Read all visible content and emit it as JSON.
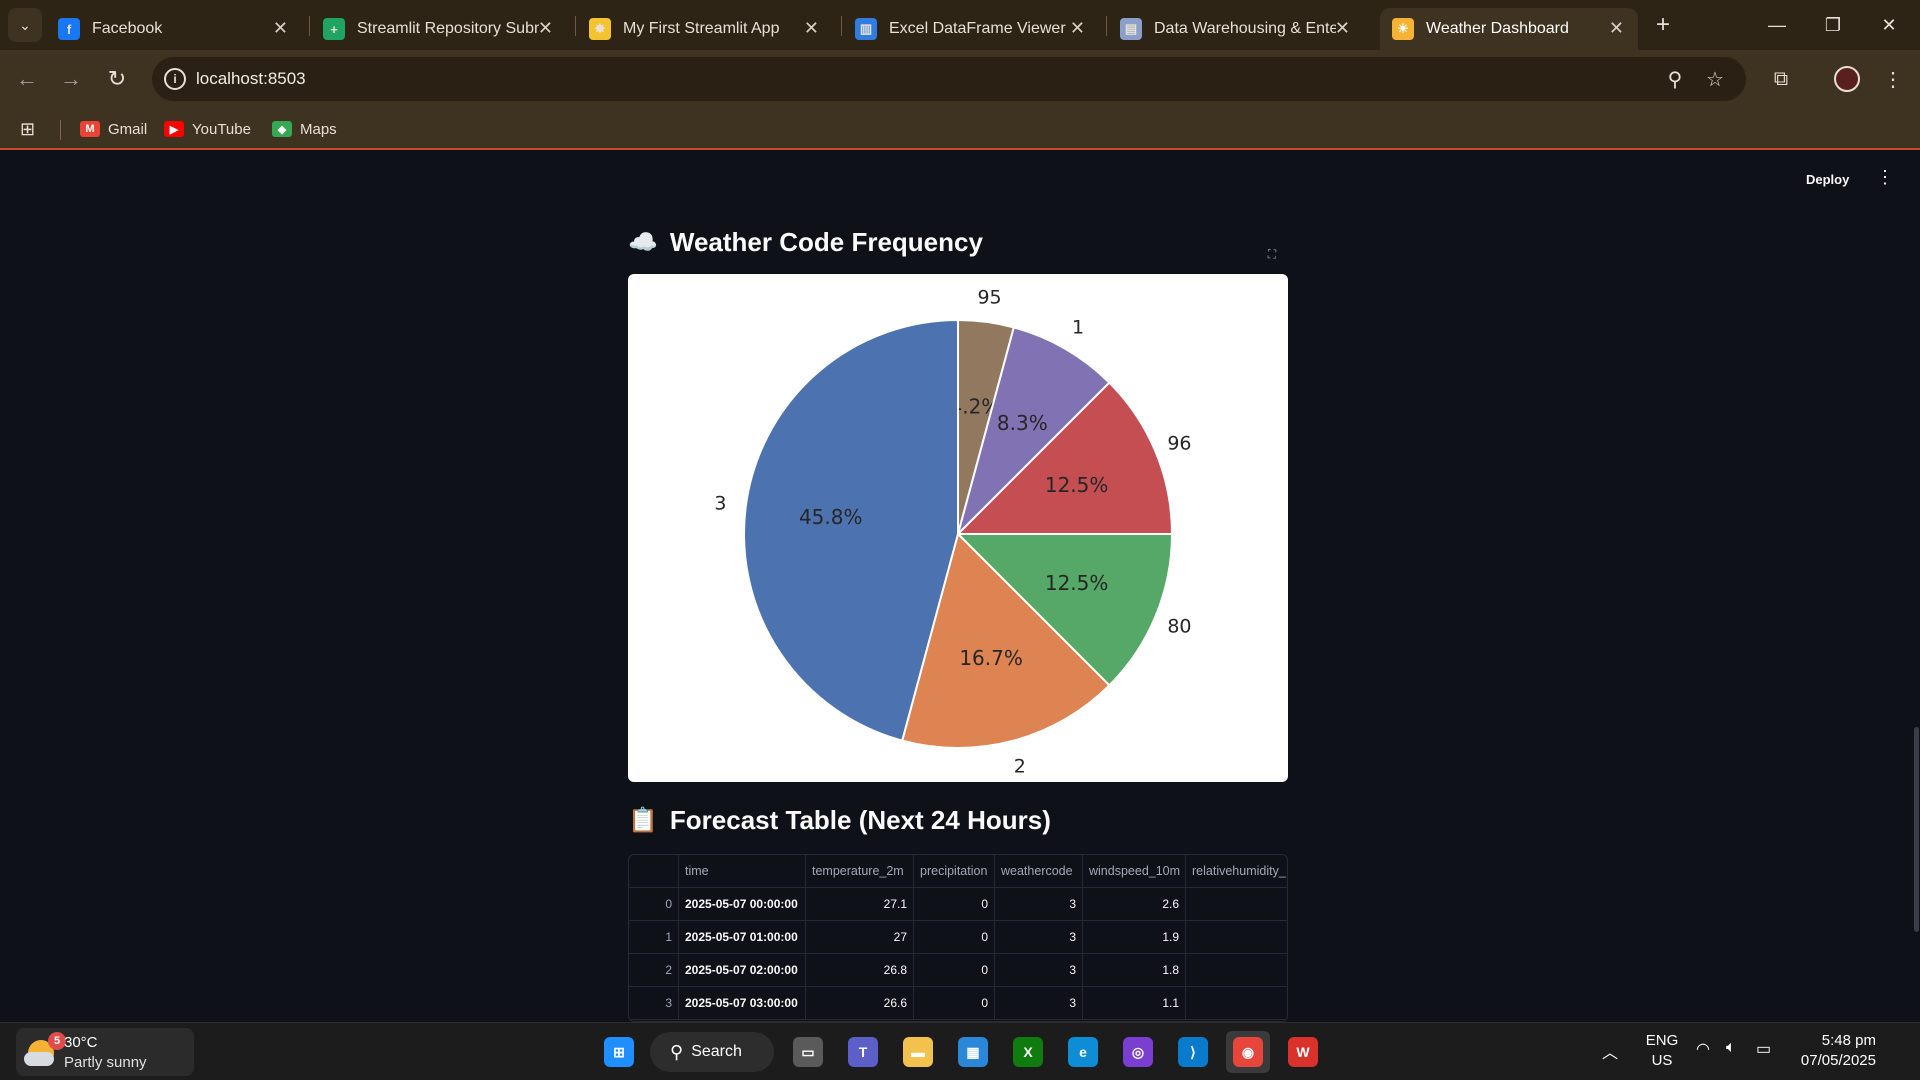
{
  "browser": {
    "tabs": [
      {
        "title": "Facebook",
        "icon": "facebook-icon",
        "color": "#1877f2",
        "glyph": "f"
      },
      {
        "title": "Streamlit Repository Submi",
        "icon": "sheets-icon",
        "color": "#1fa463",
        "glyph": "+"
      },
      {
        "title": "My First Streamlit App",
        "icon": "sparkle-icon",
        "color": "#f4c430",
        "glyph": "✸"
      },
      {
        "title": "Excel DataFrame Viewer",
        "icon": "chart-icon",
        "color": "#2f7de1",
        "glyph": "▥"
      },
      {
        "title": "Data Warehousing & Enter",
        "icon": "docs-icon",
        "color": "#8aa0c8",
        "glyph": "▤"
      },
      {
        "title": "Weather Dashboard",
        "icon": "weather-icon",
        "color": "#f5b234",
        "glyph": "☀"
      }
    ],
    "active_tab_index": 5,
    "url": "localhost:8503",
    "bookmarks": [
      {
        "label": "Gmail",
        "icon": "gmail-icon",
        "color": "#ea4335",
        "glyph": "M"
      },
      {
        "label": "YouTube",
        "icon": "youtube-icon",
        "color": "#ff0000",
        "glyph": "▶"
      },
      {
        "label": "Maps",
        "icon": "maps-icon",
        "color": "#34a853",
        "glyph": "◆"
      }
    ]
  },
  "app": {
    "deploy_label": "Deploy",
    "chart_heading_emoji": "☁️",
    "chart_heading": "Weather Code Frequency",
    "table_heading_emoji": "📋",
    "table_heading": "Forecast Table (Next 24 Hours)"
  },
  "chart_data": {
    "type": "pie",
    "title": "",
    "slices": [
      {
        "label": "95",
        "value": 4.2,
        "pct_label": "4.2%",
        "color": "#937860"
      },
      {
        "label": "1",
        "value": 8.3,
        "pct_label": "8.3%",
        "color": "#8172b3"
      },
      {
        "label": "96",
        "value": 12.5,
        "pct_label": "12.5%",
        "color": "#c44e52"
      },
      {
        "label": "80",
        "value": 12.5,
        "pct_label": "12.5%",
        "color": "#55a868"
      },
      {
        "label": "2",
        "value": 16.7,
        "pct_label": "16.7%",
        "color": "#dd8452"
      },
      {
        "label": "3",
        "value": 45.8,
        "pct_label": "45.8%",
        "color": "#4c72b0"
      }
    ]
  },
  "table": {
    "columns": [
      "",
      "time",
      "temperature_2m",
      "precipitation",
      "weathercode",
      "windspeed_10m",
      "relativehumidity_"
    ],
    "rows": [
      [
        "0",
        "2025-05-07 00:00:00",
        "27.1",
        "0",
        "3",
        "2.6",
        ""
      ],
      [
        "1",
        "2025-05-07 01:00:00",
        "27",
        "0",
        "3",
        "1.9",
        ""
      ],
      [
        "2",
        "2025-05-07 02:00:00",
        "26.8",
        "0",
        "3",
        "1.8",
        ""
      ],
      [
        "3",
        "2025-05-07 03:00:00",
        "26.6",
        "0",
        "3",
        "1.1",
        ""
      ]
    ]
  },
  "taskbar": {
    "weather_temp": "30°C",
    "weather_desc": "Partly sunny",
    "weather_badge": "5",
    "search_label": "Search",
    "lang_line1": "ENG",
    "lang_line2": "US",
    "time": "5:48 pm",
    "date": "07/05/2025",
    "apps": [
      {
        "name": "windows-start-icon",
        "color": "#1f8fff",
        "glyph": "⊞"
      },
      {
        "name": "task-view-icon",
        "color": "#5a5a5a",
        "glyph": "▭"
      },
      {
        "name": "teams-icon",
        "color": "#5b5fc7",
        "glyph": "T"
      },
      {
        "name": "file-explorer-icon",
        "color": "#f2c14e",
        "glyph": "▬"
      },
      {
        "name": "ms-store-icon",
        "color": "#2b88d8",
        "glyph": "▦"
      },
      {
        "name": "xbox-icon",
        "color": "#107c10",
        "glyph": "X"
      },
      {
        "name": "edge-icon",
        "color": "#0f8cd6",
        "glyph": "e"
      },
      {
        "name": "copilot-app-icon",
        "color": "#7a3fd0",
        "glyph": "◎"
      },
      {
        "name": "vscode-icon",
        "color": "#0a7acc",
        "glyph": "⟩"
      },
      {
        "name": "chrome-icon",
        "color": "#e8453c",
        "glyph": "◉"
      },
      {
        "name": "wps-office-icon",
        "color": "#d9322a",
        "glyph": "W"
      }
    ]
  }
}
